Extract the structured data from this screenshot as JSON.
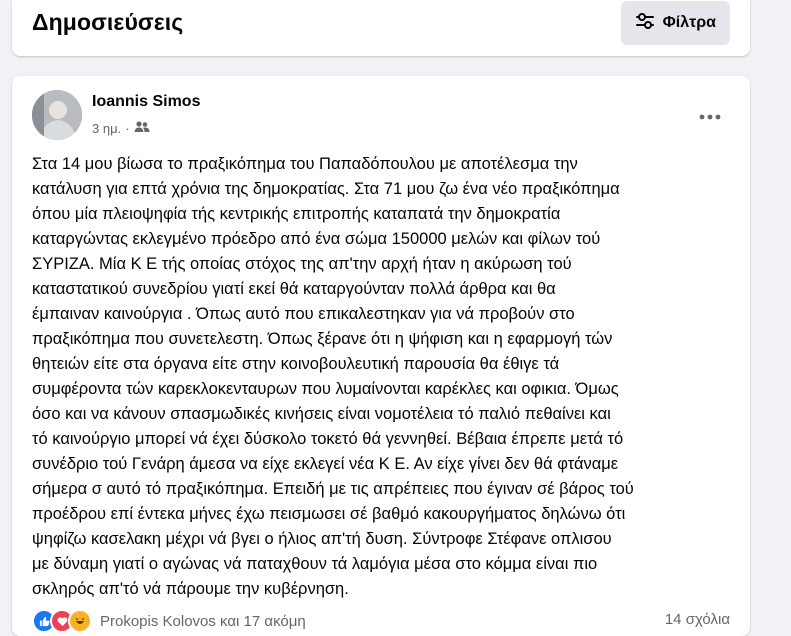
{
  "header": {
    "title": "Δημοσιεύσεις",
    "filter_label": "Φίλτρα"
  },
  "post": {
    "author": "Ioannis Simos",
    "time": "3 ημ.",
    "separator": "·",
    "privacy_icon": "friends-icon",
    "text_lines": [
      "Στα 14 μου βίωσα το πραξικόπημα του Παπαδόπουλου με αποτέλεσμα την",
      "κατάλυση για επτά χρόνια της δημοκρατίας. Στα 71 μου ζω ένα νέο πραξικόπημα",
      "όπου μία πλειοψηφία τής κεντρικής επιτροπής καταπατά την δημοκρατία",
      "καταργώντας εκλεγμένο πρόεδρο από ένα σώμα 150000 μελών και φίλων τού",
      "ΣΥΡΙΖΑ. Μία Κ Ε τής οποίας στόχος της απ'την αρχή ήταν η ακύρωση τού",
      "καταστατικού συνεδρίου γιατί εκεί θά καταργούνταν πολλά άρθρα και θα",
      "έμπαιναν καινούργια . Όπως αυτό που επικαλεστηκαν για νά προβούν στο",
      "πραξικόπημα που συνετελεστη. Όπως ξέρανε ότι η ψήφιση και η εφαρμογή τών",
      "θητειών είτε στα όργανα είτε στην κοινοβουλευτική παρουσία θα έθιγε τά",
      "συμφέροντα τών καρεκλοκενταυρων που λυμαίνονται καρέκλες και οφικια. Όμως",
      "όσο και να κάνουν σπασμωδικές κινήσεις είναι νομοτέλεια τό παλιό πεθαίνει και",
      "τό καινούργιο μπορεί νά έχει δύσκολο τοκετό θά γεννηθεί. Βέβαια έπρεπε μετά τό",
      "συνέδριο τού Γενάρη άμεσα να είχε εκλεγεί νέα Κ Ε. Αν είχε γίνει δεν θά φτάναμε",
      "σήμερα σ αυτό τό πραξικόπημα. Επειδή με τις απρέπειες που έγιναν σέ βάρος τού",
      "προέδρου επί έντεκα μήνες έχω πεισμωσει σέ βαθμό κακουργήματος δηλώνω ότι",
      "ψηφίζω κασελακη μέχρι νά βγει ο ήλιος απ'τή δυση. Σύντροφε Στέφανε οπλισου",
      "με δύναμη γιατί ο αγώνας νά παταχθουν τά λαμόγια μέσα στο κόμμα είναι πιο",
      "σκληρός απ'τό νά πάρουμε την κυβέρνηση."
    ],
    "reactions_text": "Prokopis Kolovos και 17 ακόμη",
    "comments_text": "14 σχόλια",
    "reaction_icons": [
      "like-icon",
      "love-icon",
      "haha-icon"
    ],
    "colors": {
      "like": "#1877f2",
      "love": "#f33e58",
      "haha": "#f7b125"
    }
  }
}
